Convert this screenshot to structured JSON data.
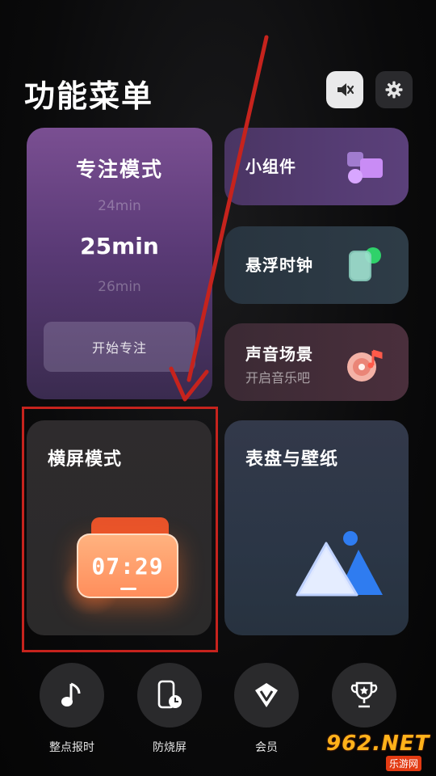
{
  "header": {
    "title": "功能菜单",
    "mute_icon": "speaker-muted-icon",
    "settings_icon": "gear-icon"
  },
  "focus": {
    "title": "专注模式",
    "prev_time": "24min",
    "current_time": "25min",
    "next_time": "26min",
    "start_label": "开始专注"
  },
  "cards": {
    "widget": {
      "title": "小组件",
      "icon": "widgets-icon"
    },
    "float_clock": {
      "title": "悬浮时钟",
      "icon": "floating-clock-icon"
    },
    "sound": {
      "title": "声音场景",
      "subtitle": "开启音乐吧",
      "icon": "music-disc-icon"
    },
    "landscape": {
      "title": "横屏模式",
      "clock_time": "07:29"
    },
    "watch": {
      "title": "表盘与壁纸",
      "icon": "image-mountain-icon"
    }
  },
  "dock": [
    {
      "label": "整点报时",
      "icon": "music-note-icon"
    },
    {
      "label": "防烧屏",
      "icon": "phone-clock-icon"
    },
    {
      "label": "会员",
      "icon": "vip-badge-icon"
    },
    {
      "label": "",
      "icon": "trophy-icon"
    }
  ],
  "watermark": {
    "big": "962.NET",
    "small": "乐游网"
  },
  "colors": {
    "annotation_red": "#c6231d",
    "clock_orange": "#ff8e5c",
    "watch_blue": "#2f7cf0"
  }
}
